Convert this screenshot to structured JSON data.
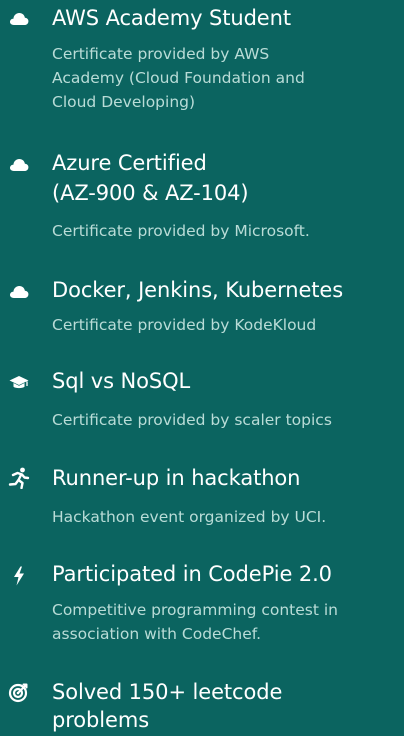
{
  "achievements": [
    {
      "icon": "cloud-icon",
      "title": "AWS Academy Student",
      "desc_lines": [
        "Certificate provided by AWS",
        "Academy (Cloud Foundation and",
        "Cloud Developing)"
      ]
    },
    {
      "icon": "cloud-icon",
      "title_lines": [
        "Azure Certified",
        "(AZ-900 & AZ-104)"
      ],
      "desc": "Certificate provided by Microsoft."
    },
    {
      "icon": "cloud-icon",
      "title": "Docker, Jenkins, Kubernetes",
      "desc": "Certificate provided by KodeKloud"
    },
    {
      "icon": "graduation-cap-icon",
      "title": "Sql vs NoSQL",
      "desc": "Certificate provided by scaler topics"
    },
    {
      "icon": "running-person-icon",
      "title": "Runner-up in hackathon",
      "desc": "Hackathon event organized by UCI."
    },
    {
      "icon": "lightning-bolt-icon",
      "title": "Participated in CodePie 2.0",
      "desc_lines": [
        "Competitive programming contest in",
        "association with CodeChef."
      ]
    },
    {
      "icon": "target-icon",
      "title_lines": [
        "Solved 150+ leetcode",
        "problems"
      ]
    }
  ]
}
